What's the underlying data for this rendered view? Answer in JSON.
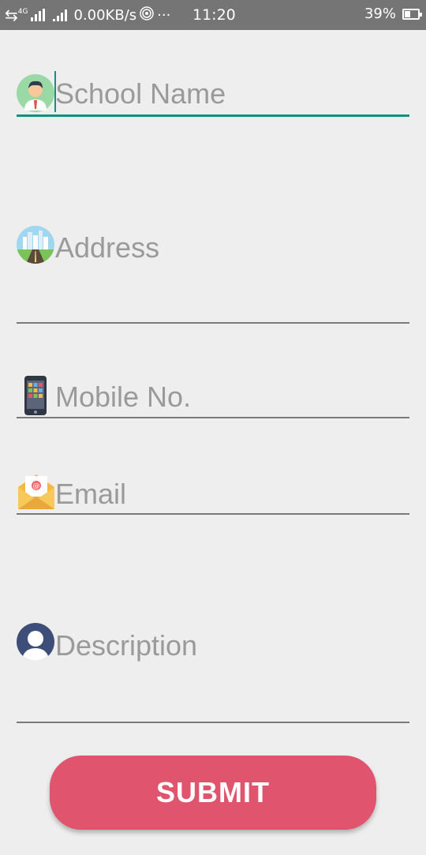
{
  "status_bar": {
    "network_type": "4G",
    "data_speed": "0.00KB/s",
    "more": "···",
    "time": "11:20",
    "battery_percent": "39%",
    "battery_level": 0.39
  },
  "form": {
    "school_name": {
      "placeholder": "School Name",
      "icon": "person-avatar-icon"
    },
    "address": {
      "placeholder": "Address",
      "icon": "city-road-icon"
    },
    "mobile": {
      "placeholder": "Mobile No.",
      "icon": "smartphone-icon"
    },
    "email": {
      "placeholder": "Email",
      "icon": "envelope-icon"
    },
    "description": {
      "placeholder": "Description",
      "icon": "user-silhouette-icon"
    }
  },
  "submit_label": "SUBMIT",
  "colors": {
    "accent": "#14907f",
    "button": "#e0546e",
    "status_bar": "#757575",
    "background": "#eeeeee",
    "hint": "#9a9a9a"
  }
}
